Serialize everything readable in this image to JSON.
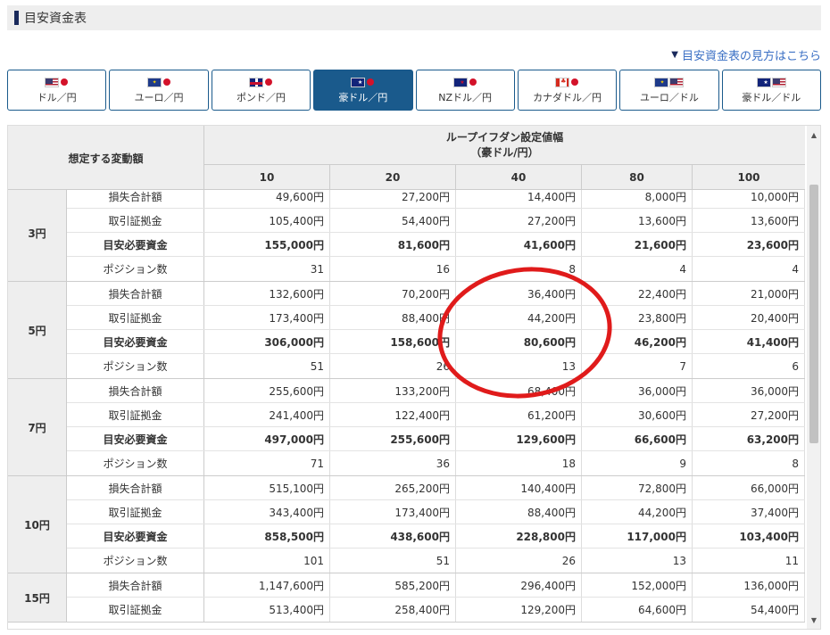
{
  "page": {
    "title": "目安資金表"
  },
  "help_link": "目安資金表の見方はこちら",
  "tabs": [
    {
      "label": "ドル／円",
      "flags": [
        "us",
        "jp"
      ]
    },
    {
      "label": "ユーロ／円",
      "flags": [
        "eu",
        "jp"
      ]
    },
    {
      "label": "ポンド／円",
      "flags": [
        "gb",
        "jp"
      ]
    },
    {
      "label": "豪ドル／円",
      "flags": [
        "au",
        "jp"
      ],
      "active": true
    },
    {
      "label": "NZドル／円",
      "flags": [
        "nz",
        "jp"
      ]
    },
    {
      "label": "カナダドル／円",
      "flags": [
        "ca",
        "jp"
      ]
    },
    {
      "label": "ユーロ／ドル",
      "flags": [
        "eu",
        "us"
      ]
    },
    {
      "label": "豪ドル／ドル",
      "flags": [
        "au",
        "us"
      ]
    }
  ],
  "table": {
    "left_header": "想定する変動額",
    "top_header_line1": "ループイフダン設定値幅",
    "top_header_line2": "（豪ドル/円）",
    "columns": [
      "10",
      "20",
      "40",
      "80",
      "100"
    ],
    "groups": [
      {
        "label": "3円",
        "rows": [
          {
            "name": "損失合計額",
            "values": [
              "49,600円",
              "27,200円",
              "14,400円",
              "8,000円",
              "10,000円"
            ]
          },
          {
            "name": "取引証拠金",
            "values": [
              "105,400円",
              "54,400円",
              "27,200円",
              "13,600円",
              "13,600円"
            ]
          },
          {
            "name": "目安必要資金",
            "bold": true,
            "values": [
              "155,000円",
              "81,600円",
              "41,600円",
              "21,600円",
              "23,600円"
            ]
          },
          {
            "name": "ポジション数",
            "values": [
              "31",
              "16",
              "8",
              "4",
              "4"
            ]
          }
        ]
      },
      {
        "label": "5円",
        "rows": [
          {
            "name": "損失合計額",
            "values": [
              "132,600円",
              "70,200円",
              "36,400円",
              "22,400円",
              "21,000円"
            ]
          },
          {
            "name": "取引証拠金",
            "values": [
              "173,400円",
              "88,400円",
              "44,200円",
              "23,800円",
              "20,400円"
            ]
          },
          {
            "name": "目安必要資金",
            "bold": true,
            "values": [
              "306,000円",
              "158,600円",
              "80,600円",
              "46,200円",
              "41,400円"
            ]
          },
          {
            "name": "ポジション数",
            "values": [
              "51",
              "26",
              "13",
              "7",
              "6"
            ]
          }
        ]
      },
      {
        "label": "7円",
        "rows": [
          {
            "name": "損失合計額",
            "values": [
              "255,600円",
              "133,200円",
              "68,400円",
              "36,000円",
              "36,000円"
            ]
          },
          {
            "name": "取引証拠金",
            "values": [
              "241,400円",
              "122,400円",
              "61,200円",
              "30,600円",
              "27,200円"
            ]
          },
          {
            "name": "目安必要資金",
            "bold": true,
            "values": [
              "497,000円",
              "255,600円",
              "129,600円",
              "66,600円",
              "63,200円"
            ]
          },
          {
            "name": "ポジション数",
            "values": [
              "71",
              "36",
              "18",
              "9",
              "8"
            ]
          }
        ]
      },
      {
        "label": "10円",
        "rows": [
          {
            "name": "損失合計額",
            "values": [
              "515,100円",
              "265,200円",
              "140,400円",
              "72,800円",
              "66,000円"
            ]
          },
          {
            "name": "取引証拠金",
            "values": [
              "343,400円",
              "173,400円",
              "88,400円",
              "44,200円",
              "37,400円"
            ]
          },
          {
            "name": "目安必要資金",
            "bold": true,
            "values": [
              "858,500円",
              "438,600円",
              "228,800円",
              "117,000円",
              "103,400円"
            ]
          },
          {
            "name": "ポジション数",
            "values": [
              "101",
              "51",
              "26",
              "13",
              "11"
            ]
          }
        ]
      },
      {
        "label": "15円",
        "rows": [
          {
            "name": "損失合計額",
            "values": [
              "1,147,600円",
              "585,200円",
              "296,400円",
              "152,000円",
              "136,000円"
            ]
          },
          {
            "name": "取引証拠金",
            "values": [
              "513,400円",
              "258,400円",
              "129,200円",
              "64,600円",
              "54,400円"
            ]
          }
        ]
      }
    ]
  },
  "colors": {
    "accent": "#1a5a8c",
    "header_bg": "#eeeeee",
    "annotation": "#e01b1b",
    "link": "#3a6fc4"
  }
}
